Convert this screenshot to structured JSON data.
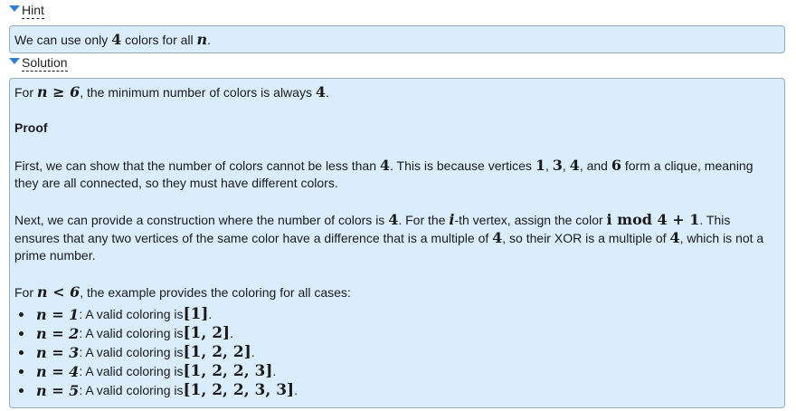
{
  "hint": {
    "toggle_label": "Hint",
    "text_prefix": "We can use only ",
    "math_4": "4",
    "text_mid": " colors for all ",
    "math_n": "n",
    "text_suffix": "."
  },
  "solution": {
    "toggle_label": "Solution",
    "intro": {
      "prefix": "For ",
      "math": "n ≥ 6",
      "mid": ", the minimum number of colors is always ",
      "math2": "4",
      "suffix": "."
    },
    "proof_title": "Proof",
    "para1": {
      "a": "First, we can show that the number of colors cannot be less than ",
      "m1": "4",
      "b": ". This is because vertices ",
      "m2": "1",
      "c": ", ",
      "m3": "3",
      "d": ", ",
      "m4": "4",
      "e": ", and ",
      "m5": "6",
      "f": " form a clique, meaning they are all connected, so they must have different colors."
    },
    "para2": {
      "a": "Next, we can provide a construction where the number of colors is ",
      "m1": "4",
      "b": ". For the ",
      "m2": "i",
      "c": "-th vertex, assign the color ",
      "m3": "i mod 4 + 1",
      "d": ". This ensures that any two vertices of the same color have a difference that is a multiple of ",
      "m4": "4",
      "e": ", so their XOR is a multiple of ",
      "m5": "4",
      "f": ", which is not a prime number."
    },
    "para3": {
      "prefix": "For ",
      "math": "n < 6",
      "suffix": ", the example provides the coloring for all cases:"
    },
    "cases": [
      {
        "eq": "n = 1",
        "text": ": A valid coloring is ",
        "coloring": "[1]",
        "end": "."
      },
      {
        "eq": "n = 2",
        "text": ": A valid coloring is ",
        "coloring": "[1, 2]",
        "end": "."
      },
      {
        "eq": "n = 3",
        "text": ": A valid coloring is ",
        "coloring": "[1, 2, 2]",
        "end": "."
      },
      {
        "eq": "n = 4",
        "text": ": A valid coloring is ",
        "coloring": "[1, 2, 2, 3]",
        "end": "."
      },
      {
        "eq": "n = 5",
        "text": ": A valid coloring is ",
        "coloring": "[1, 2, 2, 3, 3]",
        "end": "."
      }
    ]
  },
  "colors": {
    "panel_bg": "#d9edfd",
    "panel_border": "#9aa9b6",
    "toggle_arrow": "#2f7fd4"
  },
  "icons": {
    "toggle": "triangle-down-icon",
    "bullet": "bullet-dot-icon"
  }
}
